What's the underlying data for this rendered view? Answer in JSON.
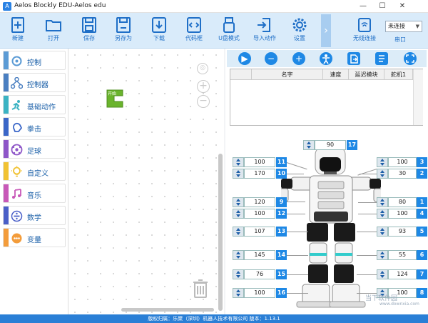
{
  "window": {
    "title": "Aelos Blockly EDU-Aelos edu",
    "minimize": "—",
    "maximize": "☐",
    "close": "✕"
  },
  "toolbar": {
    "items": [
      {
        "label": "新建",
        "icon": "new-file-icon"
      },
      {
        "label": "打开",
        "icon": "folder-open-icon"
      },
      {
        "label": "保存",
        "icon": "save-icon"
      },
      {
        "label": "另存为",
        "icon": "save-as-icon"
      },
      {
        "label": "下载",
        "icon": "download-icon"
      },
      {
        "label": "代码框",
        "icon": "code-icon"
      },
      {
        "label": "U盘模式",
        "icon": "usb-icon"
      },
      {
        "label": "导入动作",
        "icon": "import-icon"
      },
      {
        "label": "设置",
        "icon": "gear-icon"
      }
    ],
    "collapse": "›",
    "wireless_label": "无线连接",
    "connection_select": "未连接",
    "serial_label": "串口",
    "accent": "#1f6fc7",
    "bg": "#d9ebfa"
  },
  "sidebar": {
    "items": [
      {
        "label": "控制",
        "color": "#5b9bd5"
      },
      {
        "label": "控制器",
        "color": "#4a7fc1"
      },
      {
        "label": "基础动作",
        "color": "#3bb3c3"
      },
      {
        "label": "拳击",
        "color": "#3a66c8"
      },
      {
        "label": "足球",
        "color": "#8e56c8"
      },
      {
        "label": "自定义",
        "color": "#f1c232"
      },
      {
        "label": "音乐",
        "color": "#c858b8"
      },
      {
        "label": "数学",
        "color": "#4a5fc8"
      },
      {
        "label": "变量",
        "color": "#f39c3b"
      }
    ]
  },
  "workspace": {
    "start_block_label": "开始",
    "block_color": "#6ab42c"
  },
  "action_table": {
    "headers": [
      "",
      "名字",
      "速度",
      "延迟模块",
      "舵机1"
    ]
  },
  "controls": {
    "play": "▶",
    "remove": "−",
    "add": "+"
  },
  "servos": [
    {
      "id": "17",
      "value": "90"
    },
    {
      "id": "11",
      "value": "100"
    },
    {
      "id": "10",
      "value": "170"
    },
    {
      "id": "9",
      "value": "120"
    },
    {
      "id": "12",
      "value": "100"
    },
    {
      "id": "13",
      "value": "107"
    },
    {
      "id": "14",
      "value": "145"
    },
    {
      "id": "15",
      "value": "76"
    },
    {
      "id": "16",
      "value": "100"
    },
    {
      "id": "3",
      "value": "100"
    },
    {
      "id": "2",
      "value": "30"
    },
    {
      "id": "1",
      "value": "80"
    },
    {
      "id": "4",
      "value": "100"
    },
    {
      "id": "5",
      "value": "93"
    },
    {
      "id": "6",
      "value": "55"
    },
    {
      "id": "7",
      "value": "124"
    },
    {
      "id": "8",
      "value": "100"
    }
  ],
  "status": {
    "text": "版权归属：乐聚（深圳）机器人技术有限公司 版本：1.13.1"
  },
  "watermark": {
    "text": "当下软件园",
    "sub": "www.downxia.com"
  }
}
